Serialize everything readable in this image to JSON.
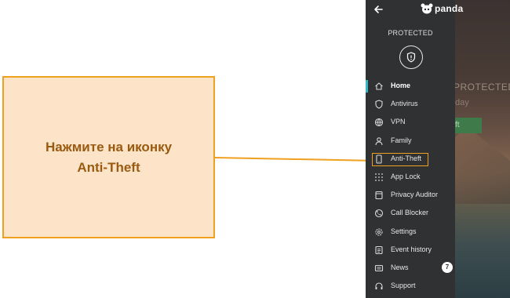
{
  "callout": {
    "line1": "Нажмите на иконку",
    "line2": "Anti-Theft"
  },
  "app": {
    "brand_name": "panda",
    "status": "PROTECTED",
    "background": {
      "status_text": "PROTECTED",
      "sub_text": "day",
      "button_text": "ft"
    },
    "menu": [
      {
        "label": "Home",
        "icon": "home-icon",
        "active": true
      },
      {
        "label": "Antivirus",
        "icon": "shield-icon"
      },
      {
        "label": "VPN",
        "icon": "globe-icon"
      },
      {
        "label": "Family",
        "icon": "person-icon"
      },
      {
        "label": "Anti-Theft",
        "icon": "phone-icon",
        "highlighted": true
      },
      {
        "label": "App Lock",
        "icon": "grid-lock-icon"
      },
      {
        "label": "Privacy Auditor",
        "icon": "document-icon"
      },
      {
        "label": "Call Blocker",
        "icon": "blocked-call-icon"
      },
      {
        "label": "Settings",
        "icon": "gear-icon"
      },
      {
        "label": "Event history",
        "icon": "list-icon"
      },
      {
        "label": "News",
        "icon": "news-icon",
        "badge": "7"
      },
      {
        "label": "Support",
        "icon": "headset-icon"
      }
    ]
  },
  "colors": {
    "callout_bg": "#fde4c8",
    "callout_border": "#f0a020",
    "callout_text": "#9a5a10",
    "drawer_bg": "#2f3133",
    "active_accent": "#35b5c7"
  }
}
